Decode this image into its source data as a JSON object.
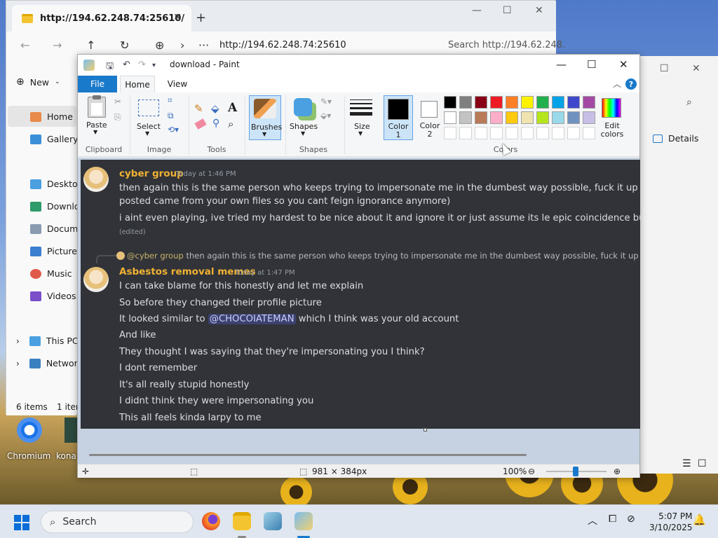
{
  "explorer": {
    "tab_title": "http://194.62.248.74:25610/",
    "address": "http://194.62.248.74:25610",
    "search_placeholder": "Search http://194.62.248.",
    "new_label": "New",
    "sidebar": [
      "Home",
      "Gallery",
      "Desktop",
      "Downloa",
      "Documen",
      "Pictures",
      "Music",
      "Videos",
      "This PC",
      "Network"
    ],
    "status_items": "6 items",
    "status_item_selected": "1 item",
    "details_label": "Details"
  },
  "paint": {
    "title": "download - Paint",
    "tabs": {
      "file": "File",
      "home": "Home",
      "view": "View"
    },
    "groups": {
      "clipboard": "Clipboard",
      "image": "Image",
      "tools": "Tools",
      "shapes": "Shapes",
      "colors": "Colors"
    },
    "buttons": {
      "paste": "Paste",
      "select": "Select",
      "brushes": "Brushes",
      "shapes": "Shapes",
      "size": "Size",
      "color1": "Color 1",
      "color2": "Color 2",
      "edit_colors": "Edit colors"
    },
    "color1": "#000000",
    "color2": "#ffffff",
    "palette_row1": [
      "#000000",
      "#7f7f7f",
      "#880015",
      "#ed1c24",
      "#ff7f27",
      "#fff200",
      "#22b14c",
      "#00a2e8",
      "#3f48cc",
      "#a349a4"
    ],
    "palette_row2": [
      "#ffffff",
      "#c3c3c3",
      "#b97a57",
      "#ffaec9",
      "#ffc90e",
      "#efe4b0",
      "#b5e61d",
      "#99d9ea",
      "#7092be",
      "#c8bfe7"
    ],
    "status": {
      "dimensions": "981 × 384px",
      "zoom": "100%"
    }
  },
  "chat": {
    "msg1": {
      "user": "cyber group",
      "time": "Today at 1:46 PM",
      "lines": [
        "then again this is the same person who keeps trying to impersonate me in the dumbest way possible, fuck it up (hint, that e",
        "posted came from your own files so you cant feign ignorance anymore)",
        "i aint even playing, ive tried my hardest to be nice about it and ignore it or just assume its le epic coincidence but now its lik"
      ],
      "edited": "(edited)"
    },
    "reply": {
      "mention": "@cyber group",
      "text": "then again this is the same person who keeps trying to impersonate me in the dumbest way possible, fuck it up (hint, that"
    },
    "msg2": {
      "user": "Asbestos removal memes",
      "time": "Today at 1:47 PM",
      "line1": "I can take blame for this honestly and let me explain",
      "line2": "So before they changed their profile picture",
      "line3_pre": "It looked similar to",
      "line3_mention": "@CHOCOIATEMAN",
      "line3_post": "which I think was your old account",
      "line4": "And like",
      "line5": "They thought I was saying that they're impersonating you I think?",
      "line6": "I dont remember",
      "line7": "It's all really stupid honestly",
      "line8": "I didnt think they were impersonating you",
      "line9": "This all feels kinda larpy to me"
    }
  },
  "desktop": {
    "icon1": "Chromium",
    "icon2": "kona"
  },
  "taskbar": {
    "search": "Search",
    "time": "5:07 PM",
    "date": "3/10/2025"
  }
}
